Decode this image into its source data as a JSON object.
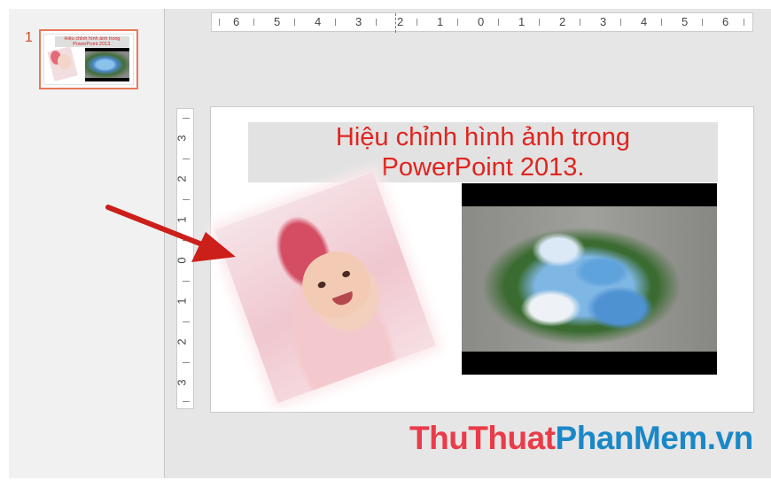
{
  "thumbnails": {
    "slide_number": "1",
    "thumb_title": "Hiệu chỉnh hình ảnh trong PowerPoint 2013."
  },
  "ruler": {
    "horizontal_labels": [
      "6",
      "5",
      "4",
      "3",
      "2",
      "1",
      "0",
      "1",
      "2",
      "3",
      "4",
      "5",
      "6"
    ],
    "vertical_labels": [
      "3",
      "2",
      "1",
      "0",
      "1",
      "2",
      "3"
    ]
  },
  "slide": {
    "title_line1": "Hiệu chỉnh hình ảnh trong",
    "title_line2": "PowerPoint 2013."
  },
  "watermark": {
    "part1": "ThuThuat",
    "part2": "PhanMem.vn"
  },
  "colors": {
    "accent": "#d24726",
    "title_red": "#e0241e",
    "arrow_red": "#cc1f1a",
    "watermark_red": "#ea3b49",
    "watermark_blue": "#1a88c8"
  }
}
